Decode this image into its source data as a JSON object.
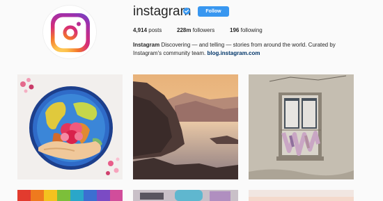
{
  "profile": {
    "username": "instagram",
    "follow_label": "Follow",
    "stats": {
      "posts_count": "4,914",
      "posts_label": "posts",
      "followers_count": "228m",
      "followers_label": "followers",
      "following_count": "196",
      "following_label": "following"
    },
    "bio": {
      "name": "Instagram",
      "text": "Discovering — and telling — stories from around the world. Curated by Instagram's community team.",
      "link": "blog.instagram.com"
    }
  },
  "posts": [
    {
      "subject": "paper-quill world map with hands holding a heart"
    },
    {
      "subject": "mountain lake at sunset"
    },
    {
      "subject": "old window with hanging clothes"
    },
    {
      "subject": "rainbow colored threads"
    },
    {
      "subject": "graffiti wall"
    },
    {
      "subject": "pale sky"
    }
  ],
  "colors": {
    "follow_button": "#3897f0",
    "link": "#003569",
    "verified_badge": "#3897f0"
  },
  "icons": [
    "instagram-logo-icon",
    "verified-badge-icon"
  ]
}
